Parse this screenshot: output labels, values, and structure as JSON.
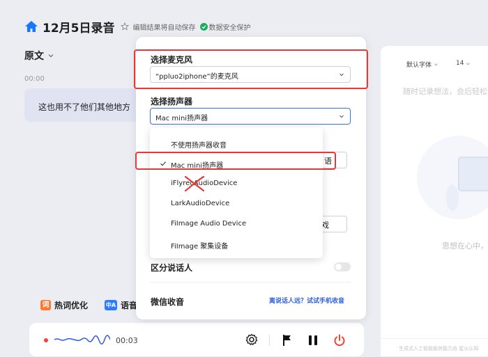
{
  "header": {
    "title": "12月5日录音",
    "autosave": "编辑结果将自动保存",
    "security": "数据安全保护",
    "accent": "#1677ff",
    "security_color": "#1aad5c"
  },
  "left": {
    "original_label": "原文",
    "timestamp": "00:00",
    "transcript": "这也用不了他们其他地方",
    "hotword_badge": "词",
    "hotword_tab": "热词优化",
    "language_badge": "中A",
    "language_tab": "语音"
  },
  "player": {
    "time": "00:03",
    "icons": [
      "record-dot-icon",
      "waveform-icon",
      "gear-icon",
      "flag-icon",
      "pause-icon",
      "power-icon"
    ]
  },
  "settings": {
    "mic_label": "选择麦克风",
    "mic_value": "“ppluo2iphone”的麦克风",
    "speaker_label": "选择扬声器",
    "speaker_value": "Mac mini扬声器",
    "speaker_options": [
      "不使用扬声器收音",
      "Mac mini扬声器",
      "iFlyrecAudioDevice",
      "LarkAudioDevice",
      "FiImage Audio Device",
      "FiImage 聚集设备"
    ],
    "selected_option": "Mac mini扬声器",
    "hidden_control_1_partial": "语",
    "hidden_control_2_partial": "戏",
    "diarize_label": "区分说话人",
    "diarize_on": false,
    "wechat_label": "微信收音",
    "phone_link": "离说话人远？试试手机收音",
    "highlight_color": "#e53935"
  },
  "right": {
    "font": "默认字体",
    "font_size": "14",
    "placeholder": "随时记录想法，会后轻松",
    "empty_text": "思想在心中，",
    "footer": "生成式人工智能服务能力由 星火认知"
  }
}
